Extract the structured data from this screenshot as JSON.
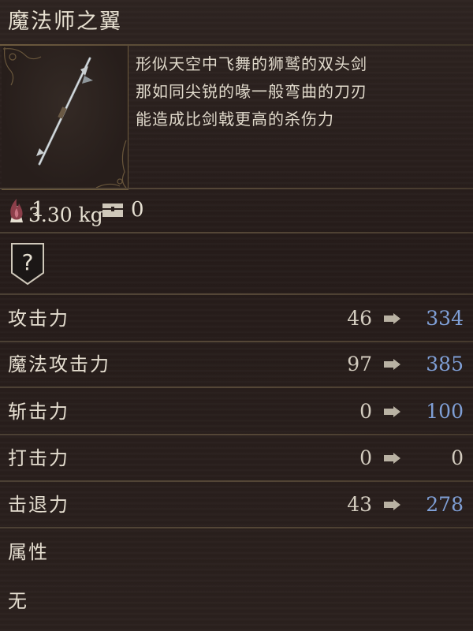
{
  "item": {
    "name": "魔法师之翼",
    "weight": "3.30 kg",
    "description": [
      "形似天空中飞舞的狮鹫的双头剑",
      "那如同尖锐的喙一般弯曲的刀刃",
      "能造成比剑戟更高的杀伤力"
    ]
  },
  "requirements": {
    "strength_icon": "strength-flame-icon",
    "strength_value": "1",
    "chest_icon": "chest-icon",
    "chest_value": "0"
  },
  "skill_slot": {
    "icon": "question-mark-shield-icon",
    "symbol": "?"
  },
  "stats": [
    {
      "label": "攻击力",
      "base": "46",
      "new": "334",
      "changed": true
    },
    {
      "label": "魔法攻击力",
      "base": "97",
      "new": "385",
      "changed": true
    },
    {
      "label": "斩击力",
      "base": "0",
      "new": "100",
      "changed": true
    },
    {
      "label": "打击力",
      "base": "0",
      "new": "0",
      "changed": false
    },
    {
      "label": "击退力",
      "base": "43",
      "new": "278",
      "changed": true
    }
  ],
  "attribute": {
    "label": "属性",
    "value": "无"
  },
  "colors": {
    "upgraded_value": "#7f9fd6",
    "normal_text": "#d3ccbf",
    "frame_gold": "#6e5c3e"
  }
}
